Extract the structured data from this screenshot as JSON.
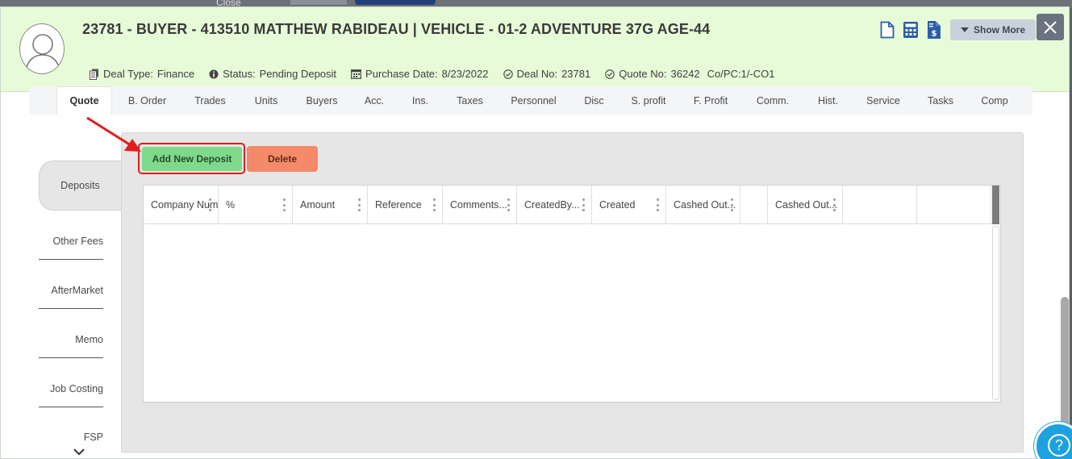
{
  "background": {
    "close_label": "Close"
  },
  "header": {
    "title": "23781 - BUYER - 413510 MATTHEW RABIDEAU | VEHICLE - 01-2 ADVENTURE 37G AGE-44",
    "deal_type_label": "Deal Type:",
    "deal_type_value": "Finance",
    "status_label": "Status:",
    "status_value": "Pending Deposit",
    "purchase_date_label": "Purchase Date:",
    "purchase_date_value": "8/23/2022",
    "deal_no_label": "Deal No:",
    "deal_no_value": "23781",
    "quote_no_label": "Quote No:",
    "quote_no_value": "36242",
    "copc_value": "Co/PC:1/-CO1",
    "show_more_label": "Show More",
    "icons": [
      "document-icon",
      "calculator-icon",
      "invoice-dollar-icon"
    ]
  },
  "tabs": [
    {
      "label": "Quote",
      "active": true
    },
    {
      "label": "B. Order"
    },
    {
      "label": "Trades"
    },
    {
      "label": "Units"
    },
    {
      "label": "Buyers"
    },
    {
      "label": "Acc."
    },
    {
      "label": "Ins."
    },
    {
      "label": "Taxes"
    },
    {
      "label": "Personnel"
    },
    {
      "label": "Disc"
    },
    {
      "label": "S. profit"
    },
    {
      "label": "F. Profit"
    },
    {
      "label": "Comm."
    },
    {
      "label": "Hist."
    },
    {
      "label": "Service"
    },
    {
      "label": "Tasks"
    },
    {
      "label": "Comp"
    }
  ],
  "side_menu": [
    {
      "label": "Deposits",
      "active": true
    },
    {
      "label": "Other Fees"
    },
    {
      "label": "AfterMarket"
    },
    {
      "label": "Memo"
    },
    {
      "label": "Job Costing"
    },
    {
      "label": "FSP"
    }
  ],
  "toolbar": {
    "add_label": "Add New Deposit",
    "delete_label": "Delete"
  },
  "grid": {
    "columns": [
      "Company Num",
      "%",
      "Amount",
      "Reference",
      "Comments...",
      "CreatedBy...",
      "Created",
      "Cashed Out...",
      "",
      "Cashed Out...",
      "",
      ""
    ],
    "rows": []
  },
  "colors": {
    "header_bg": "#e7fbd9",
    "add_button": "#7fd98b",
    "delete_button": "#f48a69",
    "highlight": "#e11c1c",
    "help": "#1ea1e0"
  }
}
